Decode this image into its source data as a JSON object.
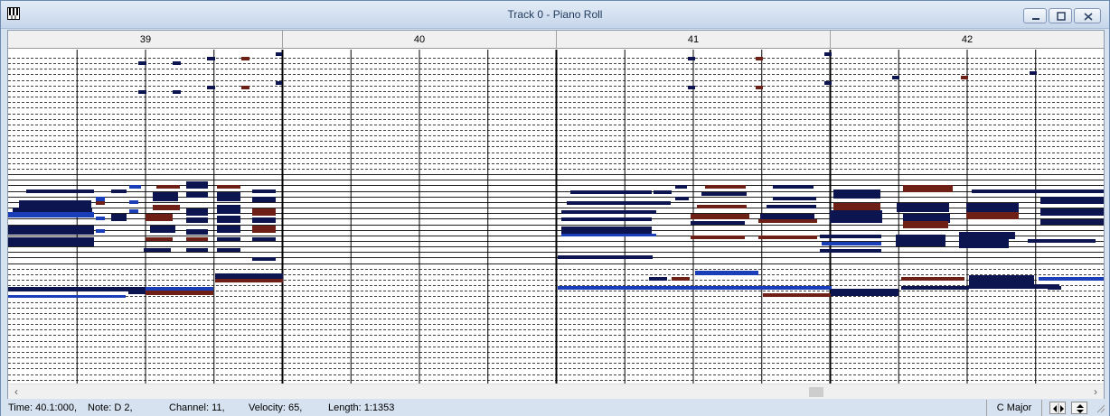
{
  "window": {
    "title": "Track 0 - Piano Roll",
    "icon": "piano-keys-icon",
    "caption_buttons": [
      "minimize-icon",
      "maximize-icon",
      "close-icon"
    ]
  },
  "ruler": {
    "measures": [
      "39",
      "40",
      "41",
      "42"
    ]
  },
  "roll": {
    "visible_measures": [
      "39",
      "40",
      "41",
      "42"
    ],
    "beats_per_measure": 4,
    "note_colors": {
      "navy": "#0d1550",
      "blue": "#1a3db8",
      "brown": "#6e1f16"
    }
  },
  "scrollbar": {
    "left_arrow": "‹",
    "right_arrow": "›"
  },
  "status": {
    "time": "Time: 40.1:000,",
    "note": "Note: D  2,",
    "channel": "Channel: 11,",
    "velocity": "Velocity: 65,",
    "length": "Length: 1:1353",
    "key": "C Major"
  }
}
